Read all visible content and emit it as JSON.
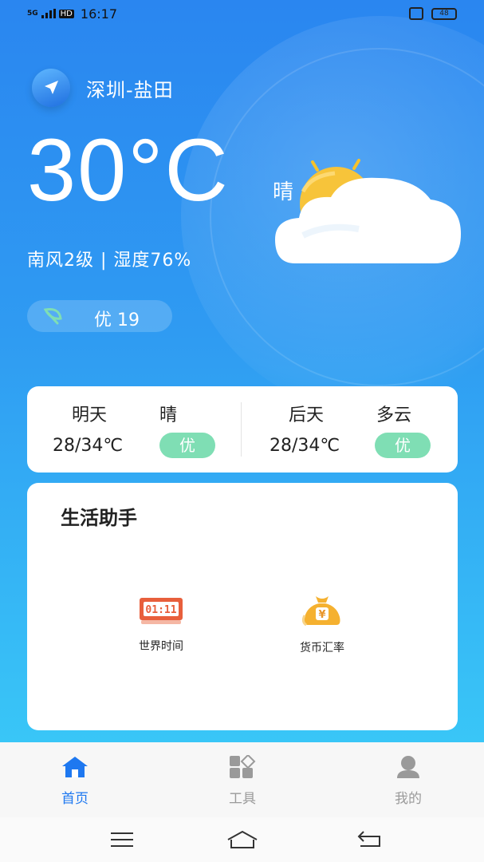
{
  "status_bar": {
    "signal": "5G",
    "hd": "HD",
    "time": "16:17",
    "battery": "48"
  },
  "location": {
    "name": "深圳-盐田"
  },
  "current": {
    "temperature": "30°C",
    "condition": "晴",
    "wind_humidity": "南风2级 | 湿度76%",
    "aqi": "优 19"
  },
  "forecast": [
    {
      "day": "明天",
      "condition": "晴",
      "temp_range": "28/34℃",
      "aqi": "优"
    },
    {
      "day": "后天",
      "condition": "多云",
      "temp_range": "28/34℃",
      "aqi": "优"
    }
  ],
  "helper": {
    "title": "生活助手",
    "tools": [
      {
        "label": "世界时间",
        "icon": "clock-icon",
        "clock_text": "01:11"
      },
      {
        "label": "货币汇率",
        "icon": "money-bag-icon",
        "currency_symbol": "¥"
      }
    ]
  },
  "tabbar": {
    "items": [
      {
        "label": "首页",
        "icon": "home-icon",
        "active": true
      },
      {
        "label": "工具",
        "icon": "tools-icon",
        "active": false
      },
      {
        "label": "我的",
        "icon": "profile-icon",
        "active": false
      }
    ],
    "active_color": "#1e78f0",
    "inactive_color": "#9a9a9a"
  },
  "colors": {
    "accent": "#2a86f0",
    "aqi_badge": "#7fdeb4"
  }
}
